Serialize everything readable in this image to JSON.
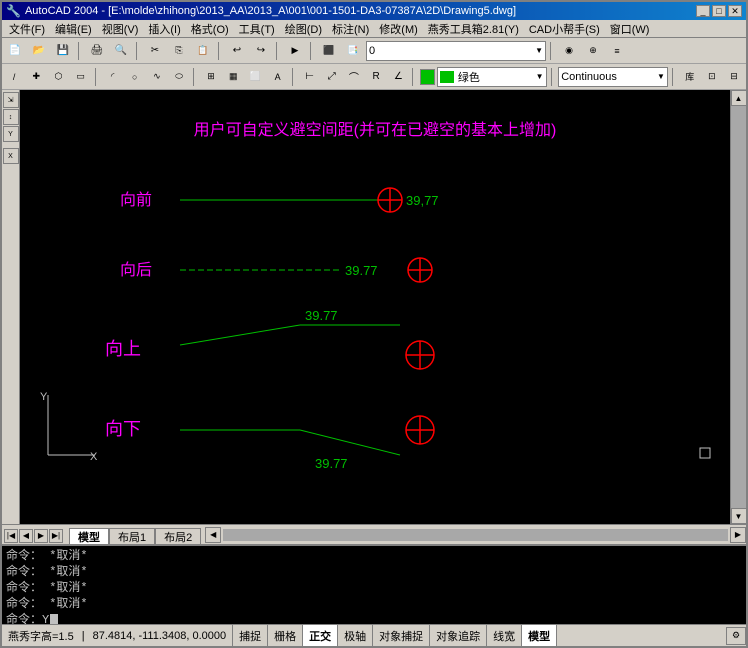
{
  "window": {
    "title": "AutoCAD 2004 - [E:\\molde\\zhihong\\2013_AA\\2013_A\\001\\001-1501-DA3-07387A\\2D\\Drawing5.dwg]",
    "icon": "autocad-icon"
  },
  "menubar": {
    "items": [
      {
        "label": "文件(F)",
        "id": "menu-file"
      },
      {
        "label": "编辑(E)",
        "id": "menu-edit"
      },
      {
        "label": "视图(V)",
        "id": "menu-view"
      },
      {
        "label": "插入(I)",
        "id": "menu-insert"
      },
      {
        "label": "格式(O)",
        "id": "menu-format"
      },
      {
        "label": "工具(T)",
        "id": "menu-tools"
      },
      {
        "label": "绘图(D)",
        "id": "menu-draw"
      },
      {
        "label": "标注(N)",
        "id": "menu-dimension"
      },
      {
        "label": "修改(M)",
        "id": "menu-modify"
      },
      {
        "label": "燕秀工具箱2.81(Y)",
        "id": "menu-yanxiu"
      },
      {
        "label": "CAD小帮手(S)",
        "id": "menu-helper"
      },
      {
        "label": "窗口(W)",
        "id": "menu-window"
      }
    ]
  },
  "toolbar1": {
    "layer": "0",
    "color_name": "绿色",
    "linetype": "Continuous"
  },
  "drawing": {
    "title": "用户可自定义避空间距(并可在已避空的基本上增加)",
    "items": [
      {
        "label": "向前",
        "value": "39,77",
        "direction": "right"
      },
      {
        "label": "向后",
        "value": "39.77",
        "direction": "right"
      },
      {
        "label": "向上",
        "value": "39.77",
        "direction": "up"
      },
      {
        "label": "向下",
        "value": "39.77",
        "direction": "down"
      }
    ]
  },
  "tabs": {
    "items": [
      {
        "label": "模型",
        "active": true
      },
      {
        "label": "布局1",
        "active": false
      },
      {
        "label": "布局2",
        "active": false
      }
    ]
  },
  "command": {
    "lines": [
      "命令：  *取消*",
      "命令：  *取消*",
      "命令：  *取消*",
      "命令：  *取消*",
      "命令：Y"
    ]
  },
  "statusbar": {
    "coord": "87.4814, -111.3408, 0.0000",
    "font_height": "燕秀字高=1.5",
    "buttons": [
      "捕捉",
      "栅格",
      "正交",
      "极轴",
      "对象捕捉",
      "对象追踪",
      "线宽",
      "模型"
    ]
  }
}
